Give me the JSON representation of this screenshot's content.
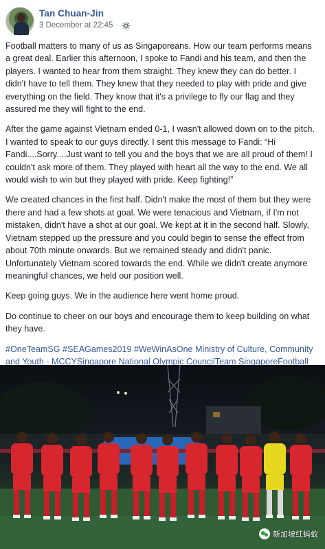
{
  "post": {
    "author": "Tan Chuan-Jin",
    "date": "3 December at 22:45",
    "separator": "·",
    "privacy_icon": "settings-gear-icon",
    "paragraphs": [
      "Football matters to many of us as Singaporeans. How our team performs means a great deal. Earlier this afternoon, I spoke to Fandi and his team, and then the players. I wanted to hear from them straight. They knew they can do better. I didn't have to tell them. They knew that they needed to play with pride and give everything on the field. They know that it's a privilege to fly our flag and they assured me they will fight to the end.",
      "After the game against Vietnam ended 0-1, I wasn't allowed down on to the pitch. I wanted to speak to our guys directly. I sent this message to Fandi: “Hi Fandi....Sorry....Just want to tell you and the boys that we are all proud of them! I couldn't ask more of them. They played with heart all the way to the end. We all would wish to win but they played with pride. Keep fighting!”",
      "We created chances in the first half. Didn't make the most of them but they were there and had a few shots at goal. We were tenacious and Vietnam, if I'm not mistaken, didn't have a shot at our goal. We kept at it in the second half. Slowly, Vietnam stepped up the pressure and you could begin to sense the effect from about 70th minute onwards. But we remained steady and didn't panic. Unfortunately Vietnam scored towards the end. While we didn't create anymore meaningful chances, we held our position well.",
      "Keep going guys. We in the audience here went home proud.",
      "Do continue to cheer on our boys and encourage them to keep building on what they have."
    ],
    "tags": {
      "t1": "#OneTeamSG",
      "t2": "#SEAGames2019",
      "t3": "#WeWinAsOne",
      "t4": "Ministry of Culture, Community and Youth - MCCY",
      "t5": "Singapore National Olympic Council",
      "t6": "Team Singapore",
      "t7": "Football Association of Singapore"
    }
  },
  "photo": {
    "watermark_text": "新加坡红蚂蚁",
    "watermark_icon": "wechat-icon",
    "colors": {
      "jersey": "#d8262e",
      "keeper": "#e6d81f",
      "pitch": "#2f5a32"
    }
  }
}
